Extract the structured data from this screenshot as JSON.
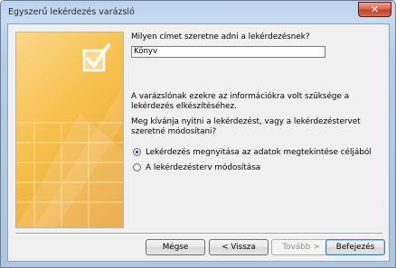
{
  "window": {
    "title": "Egyszerű lekérdezés varázsló"
  },
  "question": {
    "label": "Milyen címet szeretne adni a lekérdezésnek?"
  },
  "title_input": {
    "value": "Könyv"
  },
  "info": {
    "paragraph1": "A varázslónak ezekre az információkra volt szüksége a lekérdezés elkészítéséhez.",
    "paragraph2": "Meg kívánja nyitni a lekérdezést, vagy a lekérdezéstervet szeretné módosítani?"
  },
  "options": [
    {
      "label": "Lekérdezés megnyitása az adatok megtekintése céljából",
      "selected": true
    },
    {
      "label": "A lekérdezésterv módosítása",
      "selected": false
    }
  ],
  "buttons": {
    "cancel": "Mégse",
    "back": "< Vissza",
    "next": "Tovább >",
    "finish": "Befejezés"
  },
  "icons": {
    "close": "close-icon",
    "wizard": "checkbox-check-icon"
  }
}
